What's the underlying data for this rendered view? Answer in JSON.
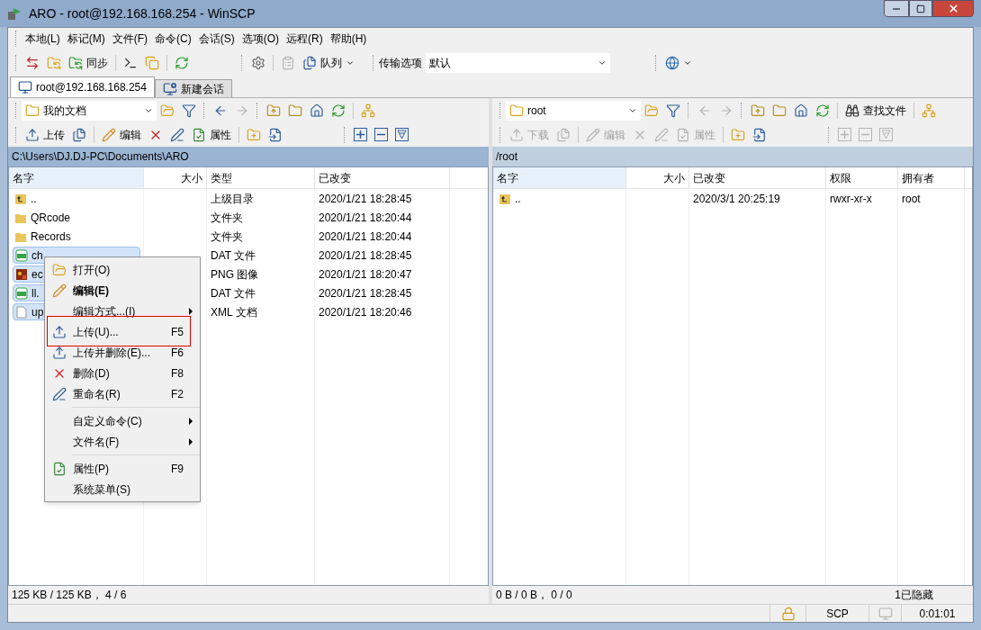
{
  "window": {
    "title": "ARO - root@192.168.168.254 - WinSCP"
  },
  "menu": [
    "本地(L)",
    "标记(M)",
    "文件(F)",
    "命令(C)",
    "会话(S)",
    "选项(O)",
    "远程(R)",
    "帮助(H)"
  ],
  "toolbar": {
    "sync_label": "同步",
    "queue_label": "队列",
    "transfer_label": "传输选项",
    "transfer_value": "默认"
  },
  "session_tabs": [
    {
      "label": "root@192.168.168.254",
      "selected": true
    },
    {
      "label": "新建会话",
      "selected": false
    }
  ],
  "panes": [
    {
      "location": "我的文档",
      "back_disabled": false,
      "transfer": {
        "label": "上传",
        "disabled": false
      },
      "edit": {
        "label": "编辑",
        "disabled": false
      },
      "props": {
        "label": "属性",
        "disabled": false
      },
      "path": "C:\\Users\\DJ.DJ-PC\\Documents\\ARO",
      "active": true,
      "columns": [
        "名字",
        "大小",
        "类型",
        "已改变"
      ],
      "rows": [
        {
          "kind": "parent",
          "selected": false,
          "cells": [
            "..",
            null,
            "上级目录",
            "2020/1/21   18:28:45"
          ]
        },
        {
          "kind": "folder",
          "selected": false,
          "cells": [
            "QRcode",
            null,
            "文件夹",
            "2020/1/21   18:20:44"
          ]
        },
        {
          "kind": "folder",
          "selected": false,
          "cells": [
            "Records",
            null,
            "文件夹",
            "2020/1/21   18:20:44"
          ]
        },
        {
          "kind": "video",
          "selected": true,
          "cells": [
            "ch",
            null,
            "DAT 文件",
            "2020/1/21   18:28:45"
          ]
        },
        {
          "kind": "image",
          "selected": true,
          "cells": [
            "ec",
            null,
            "PNG 图像",
            "2020/1/21   18:20:47"
          ]
        },
        {
          "kind": "video",
          "selected": true,
          "cells": [
            "ll.",
            null,
            "DAT 文件",
            "2020/1/21   18:28:45"
          ]
        },
        {
          "kind": "document",
          "selected": true,
          "cells": [
            "up",
            null,
            "XML 文档",
            "2020/1/21   18:20:46"
          ]
        }
      ],
      "status": "125 KB / 125 KB， 4 / 6"
    },
    {
      "location": "root",
      "back_disabled": true,
      "transfer": {
        "label": "下载",
        "disabled": true
      },
      "edit": {
        "label": "编辑",
        "disabled": true
      },
      "props": {
        "label": "属性",
        "disabled": true
      },
      "find_label": "查找文件",
      "path": "/root",
      "active": false,
      "columns": [
        "名字",
        "大小",
        "已改变",
        "权限",
        "拥有者"
      ],
      "rows": [
        {
          "kind": "parent",
          "selected": false,
          "cells": [
            "..",
            null,
            "2020/3/1 20:25:19",
            "rwxr-xr-x",
            "root"
          ]
        }
      ],
      "status": "0 B / 0 B， 0 / 0",
      "hidden_note": "1已隐藏"
    }
  ],
  "context_menu": [
    {
      "kind": "open",
      "label": "打开(O)",
      "bold": false,
      "submenu": false,
      "boxed": false
    },
    {
      "kind": "edit",
      "label": "编辑(E)",
      "bold": true,
      "submenu": false,
      "boxed": false
    },
    {
      "kind": "plain",
      "label": "编辑方式...(I)",
      "bold": false,
      "submenu": true,
      "boxed": false
    },
    {
      "kind": "upload",
      "label": "上传(U)...",
      "shortcut": "F5",
      "bold": false,
      "submenu": false,
      "boxed": true
    },
    {
      "kind": "upload",
      "label": "上传并删除(E)...",
      "shortcut": "F6",
      "bold": false,
      "submenu": false,
      "boxed": false
    },
    {
      "kind": "delete",
      "label": "删除(D)",
      "shortcut": "F8",
      "bold": false,
      "submenu": false,
      "boxed": false
    },
    {
      "kind": "rename",
      "label": "重命名(R)",
      "shortcut": "F2",
      "bold": false,
      "submenu": false,
      "boxed": false
    },
    {
      "kind": "separator"
    },
    {
      "kind": "plain",
      "label": "自定义命令(C)",
      "bold": false,
      "submenu": true,
      "boxed": false
    },
    {
      "kind": "plain",
      "label": "文件名(F)",
      "bold": false,
      "submenu": true,
      "boxed": false
    },
    {
      "kind": "separator"
    },
    {
      "kind": "properties",
      "label": "属性(P)",
      "shortcut": "F9",
      "bold": false,
      "submenu": false,
      "boxed": false
    },
    {
      "kind": "plain",
      "label": "系统菜单(S)",
      "bold": false,
      "submenu": false,
      "boxed": false
    }
  ],
  "status_bar": {
    "protocol": "SCP",
    "elapsed": "0:01:01"
  }
}
